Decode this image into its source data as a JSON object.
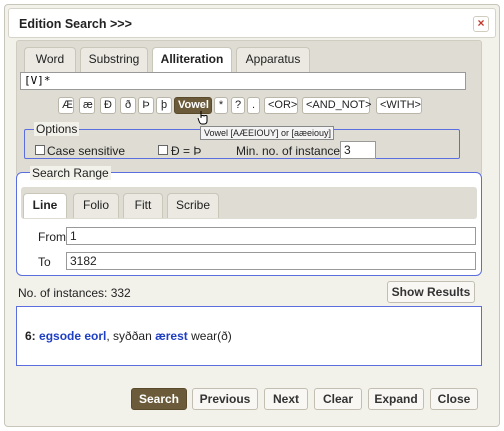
{
  "window": {
    "title": "Edition Search   >>>",
    "close_label": "×"
  },
  "tabs": [
    "Word",
    "Substring",
    "Alliteration",
    "Apparatus"
  ],
  "active_tab": "Alliteration",
  "pattern": {
    "value": "[V]*"
  },
  "char_buttons": [
    "Æ",
    "æ",
    "Ð",
    "ð",
    "Þ",
    "þ",
    "Vowel",
    "*",
    "?",
    ".",
    "<OR>",
    "<AND_NOT>",
    "<WITH>"
  ],
  "tooltip": "Vowel [AÆEIOUY] or [aæeiouy]",
  "options": {
    "legend": "Options",
    "case_sensitive_label": "Case sensitive",
    "eth_thorn_label": "Ð = Þ",
    "min_instances_label": "Min. no. of instances",
    "min_instances_value": "3"
  },
  "range": {
    "legend": "Search Range",
    "tabs": [
      "Line",
      "Folio",
      "Fitt",
      "Scribe"
    ],
    "from_label": "From",
    "from_value": "1",
    "to_label": "To",
    "to_value": "3182"
  },
  "instances_text": "No. of instances: 332",
  "show_results_label": "Show Results",
  "result": {
    "num": "6:",
    "w1": "egsode",
    "w2": "eorl",
    "sep": ",  syððan ",
    "w3": "ærest",
    "tail": " wear(ð)"
  },
  "buttons": [
    "Search",
    "Previous",
    "Next",
    "Clear",
    "Expand",
    "Close"
  ],
  "colors": {
    "accent": "#6b5b3a",
    "border_blue": "#5b6ee0",
    "match_blue": "#1f3fc2"
  }
}
